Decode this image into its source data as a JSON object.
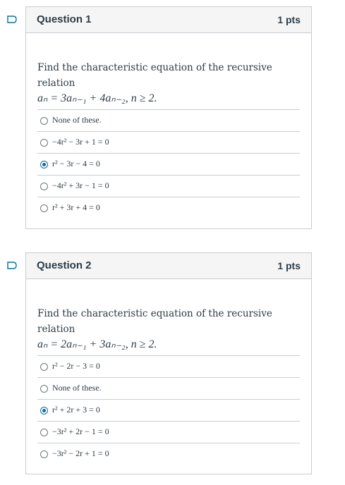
{
  "quiz": {
    "questions": [
      {
        "title": "Question 1",
        "points": "1 pts",
        "prompt": "Find the characteristic equation of the recursive relation",
        "relation": "aₙ = 3aₙ₋₁ + 4aₙ₋₂,  n ≥ 2.",
        "answers": [
          {
            "label": "None of these.",
            "selected": false
          },
          {
            "label": "−4r² − 3r + 1 = 0",
            "selected": false
          },
          {
            "label": "r² − 3r − 4 = 0",
            "selected": true
          },
          {
            "label": "−4r² + 3r − 1 = 0",
            "selected": false
          },
          {
            "label": "r² + 3r + 4 = 0",
            "selected": false
          }
        ]
      },
      {
        "title": "Question 2",
        "points": "1 pts",
        "prompt": "Find the characteristic equation of the recursive relation",
        "relation": "aₙ = 2aₙ₋₁ + 3aₙ₋₂,  n ≥ 2.",
        "answers": [
          {
            "label": "r² − 2r − 3 = 0",
            "selected": false
          },
          {
            "label": "None of these.",
            "selected": false
          },
          {
            "label": "r² + 2r + 3 = 0",
            "selected": true
          },
          {
            "label": "−3r² + 2r − 1 = 0",
            "selected": false
          },
          {
            "label": "−3r² − 2r + 1 = 0",
            "selected": false
          }
        ]
      }
    ],
    "colors": {
      "accent": "#0770a3",
      "border": "#c7cdd1",
      "header_bg": "#f5f5f5",
      "text": "#2d3b45"
    },
    "icons": {
      "flag": "bookmark-flag-icon"
    }
  }
}
